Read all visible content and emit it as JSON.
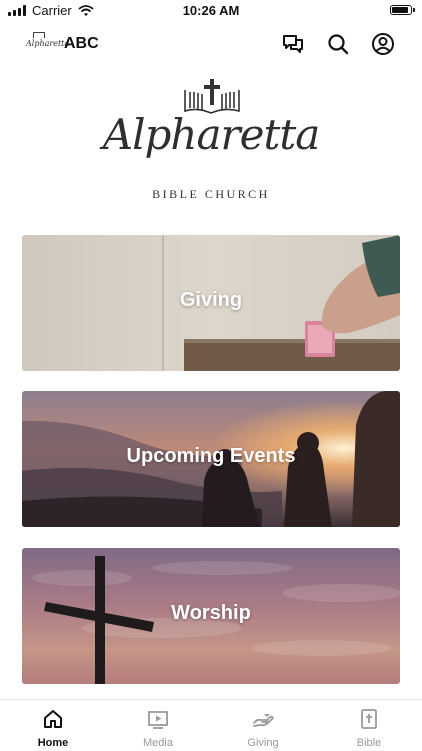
{
  "status_bar": {
    "carrier": "Carrier",
    "time": "10:26 AM"
  },
  "header": {
    "app_name": "ABC",
    "mini_logo_text": "Alpharetta"
  },
  "logo": {
    "script_text": "Alpharetta",
    "subtitle": "BIBLE CHURCH"
  },
  "cards": [
    {
      "label": "Giving"
    },
    {
      "label": "Upcoming Events"
    },
    {
      "label": "Worship"
    }
  ],
  "tabs": [
    {
      "label": "Home",
      "icon": "home-icon",
      "active": true
    },
    {
      "label": "Media",
      "icon": "media-icon",
      "active": false
    },
    {
      "label": "Giving",
      "icon": "giving-hand-icon",
      "active": false
    },
    {
      "label": "Bible",
      "icon": "bible-icon",
      "active": false
    }
  ]
}
